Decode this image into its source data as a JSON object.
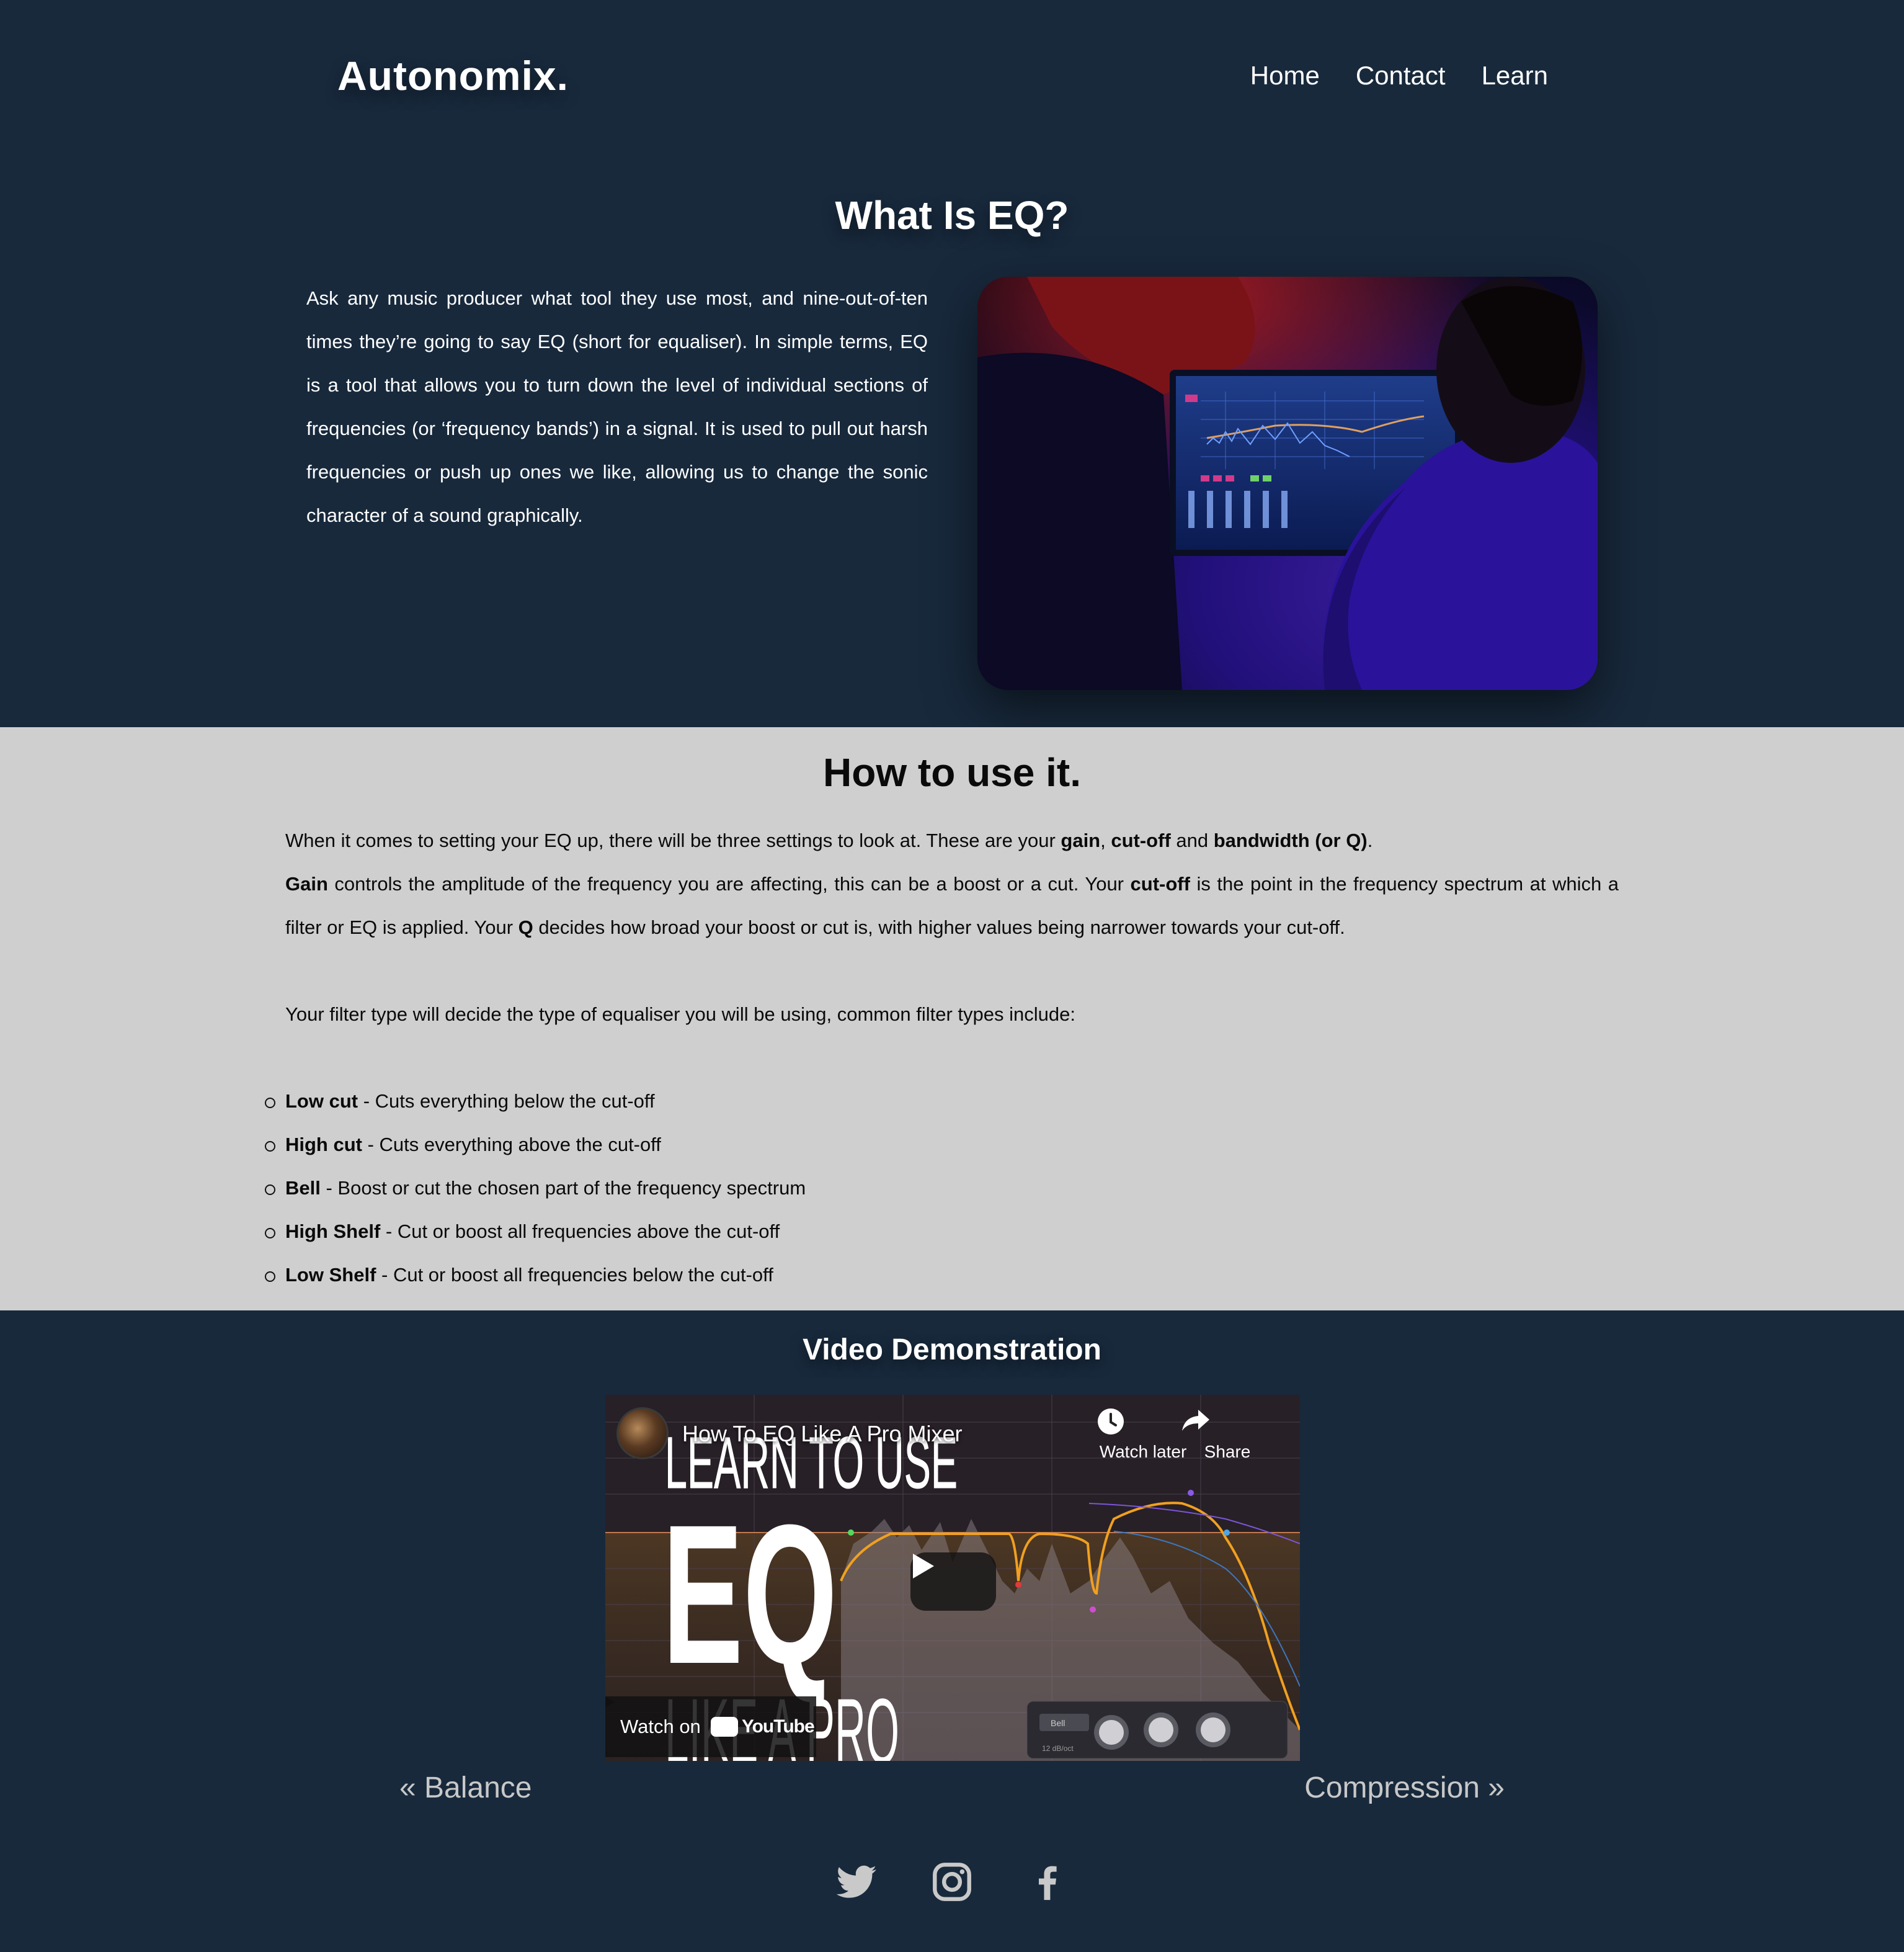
{
  "header": {
    "logo": "Autonomix.",
    "nav": [
      "Home",
      "Contact",
      "Learn"
    ]
  },
  "intro": {
    "title": "What Is EQ?",
    "text": "Ask any music producer what tool they use most, and nine-out-of-ten times they’re going to say EQ (short for equaliser). In simple terms, EQ is a tool that allows you to turn down the level of individual sections of frequencies (or ‘frequency bands’) in a signal. It is used to pull out harsh frequencies or push up ones we like, allowing us to change the sonic character of a sound graphically.",
    "image_subject": "producer-at-mixing-console-photo"
  },
  "howto": {
    "title": "How to use it.",
    "p1": {
      "a": "When it comes to setting your EQ up, there will be three settings to look at. These are your ",
      "b1": "gain",
      "c": ", ",
      "b2": "cut-off",
      "d": " and ",
      "b3": "bandwidth (or Q)",
      "e": "."
    },
    "p2": {
      "b1": "Gain",
      "a": " controls the amplitude of the frequency you are affecting, this can be a boost or a cut. Your ",
      "b2": "cut-off",
      "c": " is the point in the frequency spectrum at which a filter or EQ is applied. Your ",
      "b3": "Q",
      "d": " decides how broad your boost or cut is, with higher values being narrower towards your cut-off."
    },
    "p3": "Your filter type will decide the type of equaliser you will be using, common filter types include:",
    "filters": [
      {
        "name": "Low cut",
        "desc": " - Cuts everything below the cut-off"
      },
      {
        "name": "High cut",
        "desc": " - Cuts everything above the cut-off"
      },
      {
        "name": "Bell",
        "desc": " - Boost or cut the chosen part of the frequency spectrum"
      },
      {
        "name": "High Shelf",
        "desc": " - Cut or boost all frequencies above the cut-off"
      },
      {
        "name": "Low Shelf",
        "desc": " - Cut or boost all frequencies below the cut-off"
      }
    ]
  },
  "video": {
    "section_title": "Video Demonstration",
    "title": "How To EQ Like A Pro Mixer",
    "watch_later": "Watch later",
    "share": "Share",
    "watch_on": "Watch on",
    "youtube": "YouTube",
    "thumb_line1": "LEARN TO USE",
    "thumb_line2": "EQ",
    "thumb_line3": "LIKE A PRO",
    "thumb_knob_label": "Bell",
    "thumb_knob_value": "12 dB/oct"
  },
  "pager": {
    "prev": "« Balance",
    "next": "Compression »"
  },
  "social": [
    "twitter-icon",
    "instagram-icon",
    "facebook-icon"
  ],
  "colors": {
    "navy": "#18293c",
    "light_section": "#cfcfcf",
    "eq_curve": "#f0a020",
    "pager_text": "#c8c8c8"
  }
}
